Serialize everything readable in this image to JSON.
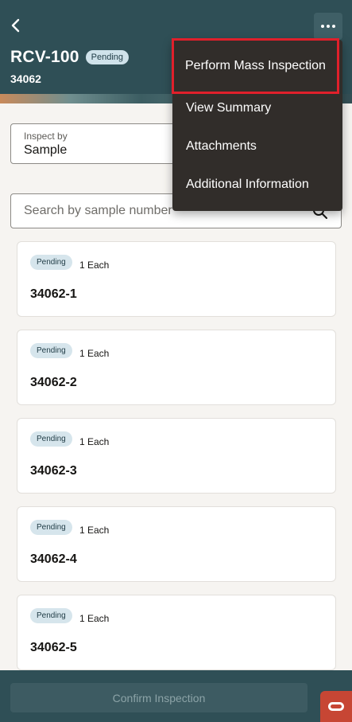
{
  "header": {
    "title": "RCV-100",
    "status": "Pending",
    "subtitle": "34062"
  },
  "inspect_by": {
    "label": "Inspect by",
    "value": "Sample"
  },
  "search": {
    "placeholder": "Search by sample number"
  },
  "samples": [
    {
      "status": "Pending",
      "quantity": "1 Each",
      "number": "34062-1"
    },
    {
      "status": "Pending",
      "quantity": "1 Each",
      "number": "34062-2"
    },
    {
      "status": "Pending",
      "quantity": "1 Each",
      "number": "34062-3"
    },
    {
      "status": "Pending",
      "quantity": "1 Each",
      "number": "34062-4"
    },
    {
      "status": "Pending",
      "quantity": "1 Each",
      "number": "34062-5"
    }
  ],
  "menu": {
    "items": [
      {
        "label": "Perform Mass Inspection"
      },
      {
        "label": "View Summary"
      },
      {
        "label": "Attachments"
      },
      {
        "label": "Additional Information"
      }
    ]
  },
  "footer": {
    "confirm_label": "Confirm Inspection"
  },
  "colors": {
    "header_bg": "#2f4f56",
    "menu_bg": "#312d2a",
    "highlight": "#e0202b",
    "brand": "#c74634"
  },
  "icons": {
    "back": "chevron-left-icon",
    "more": "more-horizontal-icon",
    "search": "search-icon",
    "logo": "oracle-logo-icon"
  }
}
